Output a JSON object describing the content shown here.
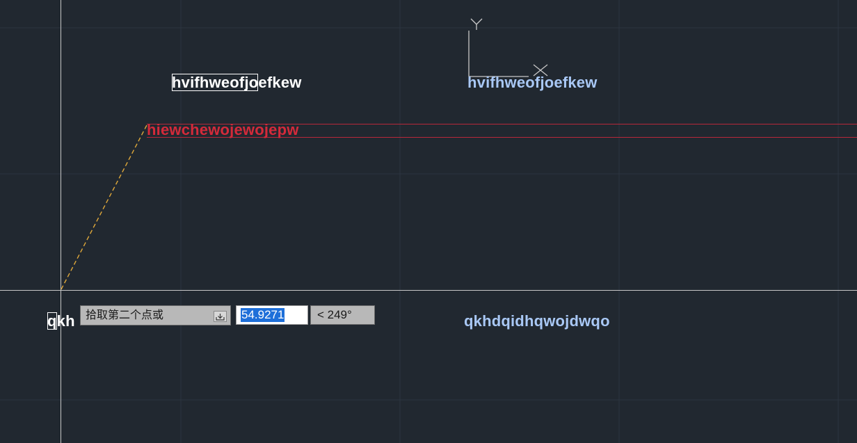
{
  "texts": {
    "text_white_top_first": "hvifhweofjo",
    "text_white_top_rest": "efkew",
    "text_blue_top": "hvifhweofjoefkew",
    "text_red": "hiewchewojewojepw",
    "text_white_bottom_char": "q",
    "text_white_bottom_rest": "kh",
    "text_blue_bottom": "qkhdqidhqwojdwqo"
  },
  "ucs_icon": {
    "x_label": "X",
    "y_label": "Y"
  },
  "command_prompt": {
    "label": "拾取第二个点或",
    "distance_value": "54.9271",
    "angle_value": "< 249°"
  },
  "colors": {
    "background": "#212830",
    "grid": "#2c3440",
    "crosshair": "#c8c8c8",
    "rubber_band": "#e0a93a",
    "highlight_red": "#d42a3a",
    "text_blue": "#a9c8f5",
    "selection_blue": "#1e6fd9"
  },
  "icons": {
    "dropdown": "download-arrow-icon"
  }
}
